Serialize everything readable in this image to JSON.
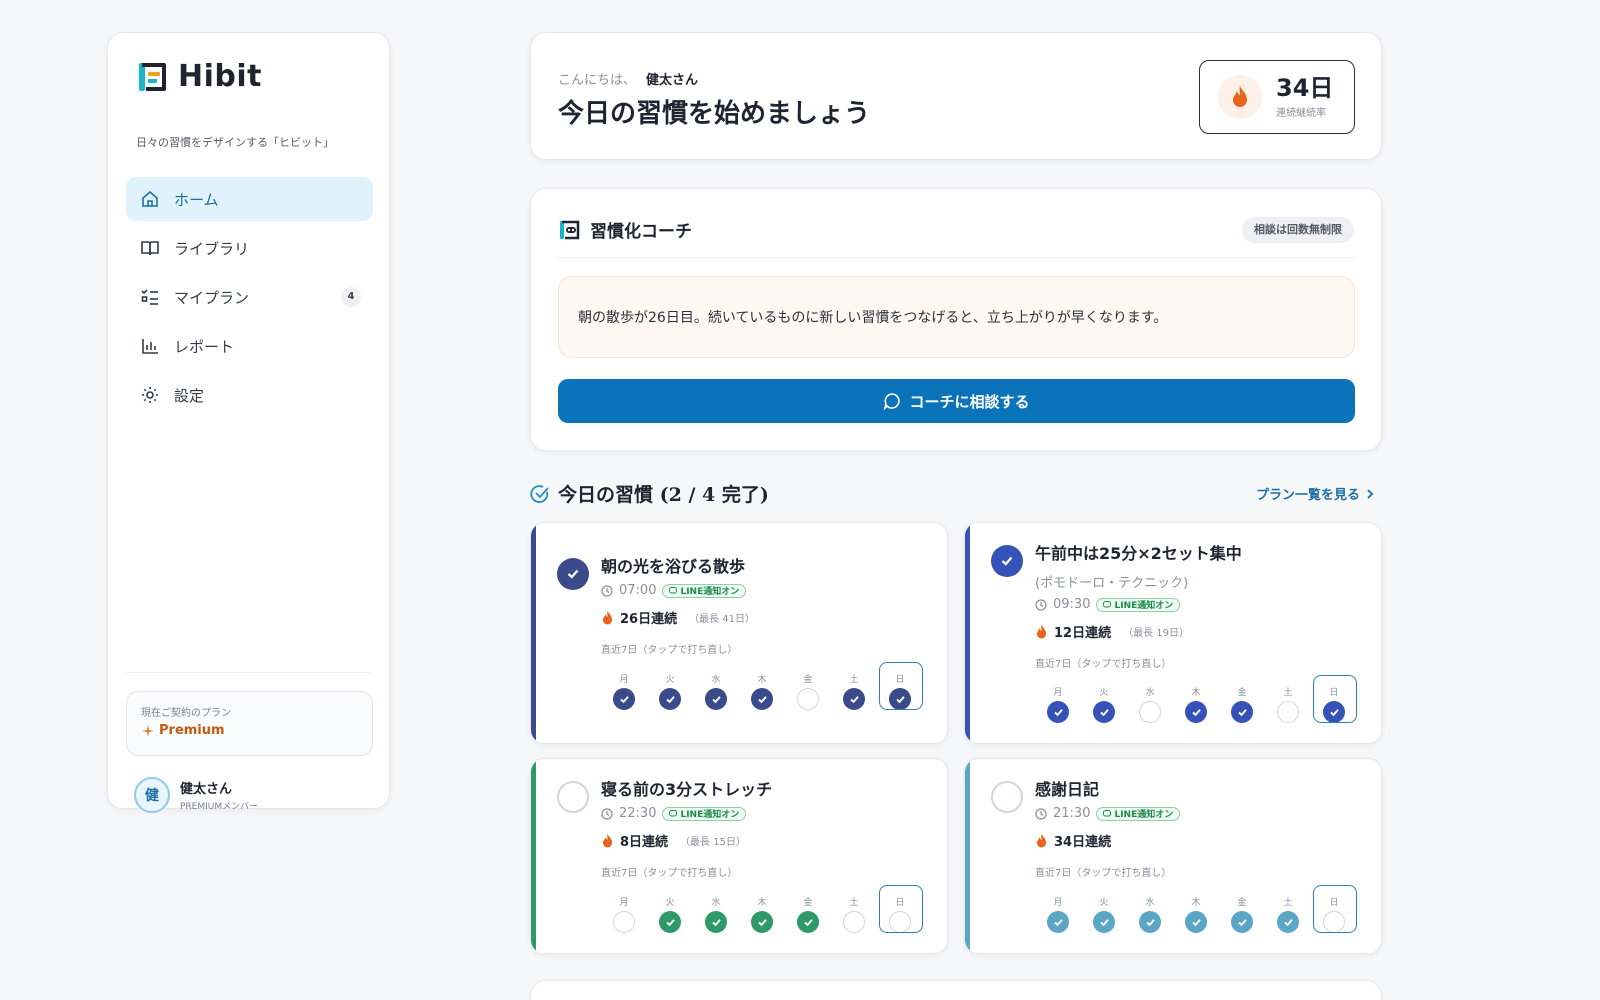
{
  "app": {
    "name": "Hibit",
    "tagline": "日々の習慣をデザインする「ヒビット」"
  },
  "sidebar": {
    "items": [
      {
        "label": "ホーム",
        "icon": "home-icon",
        "active": true
      },
      {
        "label": "ライブラリ",
        "icon": "book-icon"
      },
      {
        "label": "マイプラン",
        "icon": "checklist-icon",
        "badge": "4"
      },
      {
        "label": "レポート",
        "icon": "bar-chart-icon"
      },
      {
        "label": "設定",
        "icon": "gear-icon"
      }
    ],
    "plan": {
      "label": "現在ご契約のプラン",
      "name": "Premium"
    },
    "user": {
      "initial": "健",
      "name": "健太さん",
      "role": "PREMIUMメンバー"
    }
  },
  "greeting": {
    "hello": "こんにちは、",
    "name": "健太さん",
    "title": "今日の習慣を始めましょう",
    "streak_value": "34日",
    "streak_label": "連続継続率"
  },
  "coach": {
    "title": "習慣化コーチ",
    "tag": "相談は回数無制限",
    "message": "朝の散歩が26日目。続いているものに新しい習慣をつなげると、立ち上がりが早くなります。",
    "button": "コーチに相談する"
  },
  "today": {
    "title": "今日の習慣 (2 / 4 完了)",
    "link": "プラン一覧を見る"
  },
  "day_labels": [
    "月",
    "火",
    "水",
    "木",
    "金",
    "土",
    "日"
  ],
  "habits": [
    {
      "title": "朝の光を浴びる散歩",
      "subtitle": "",
      "time": "07:00",
      "line": "LINE通知オン",
      "streak": "26日連続",
      "best": "（最長 41日）",
      "recent": "直近7日（タップで打ち直し）",
      "done": true,
      "color": "#3b4a8a",
      "days": [
        true,
        true,
        true,
        true,
        false,
        true,
        true
      ]
    },
    {
      "title": "午前中は25分×2セット集中",
      "subtitle": "(ポモドーロ・テクニック)",
      "time": "09:30",
      "line": "LINE通知オン",
      "streak": "12日連続",
      "best": "（最長 19日）",
      "recent": "直近7日（タップで打ち直し）",
      "done": true,
      "color": "#3552b8",
      "days": [
        true,
        true,
        false,
        true,
        true,
        false,
        true
      ]
    },
    {
      "title": "寝る前の3分ストレッチ",
      "subtitle": "",
      "time": "22:30",
      "line": "LINE通知オン",
      "streak": "8日連続",
      "best": "（最長 15日）",
      "recent": "直近7日（タップで打ち直し）",
      "done": false,
      "color": "#2e9a6a",
      "days": [
        false,
        true,
        true,
        true,
        true,
        false,
        false
      ]
    },
    {
      "title": "感謝日記",
      "subtitle": "",
      "time": "21:30",
      "line": "LINE通知オン",
      "streak": "34日連続",
      "best": "",
      "recent": "直近7日（タップで打ち直し）",
      "done": false,
      "color": "#5aa6c4",
      "days": [
        true,
        true,
        true,
        true,
        true,
        true,
        false
      ]
    }
  ]
}
